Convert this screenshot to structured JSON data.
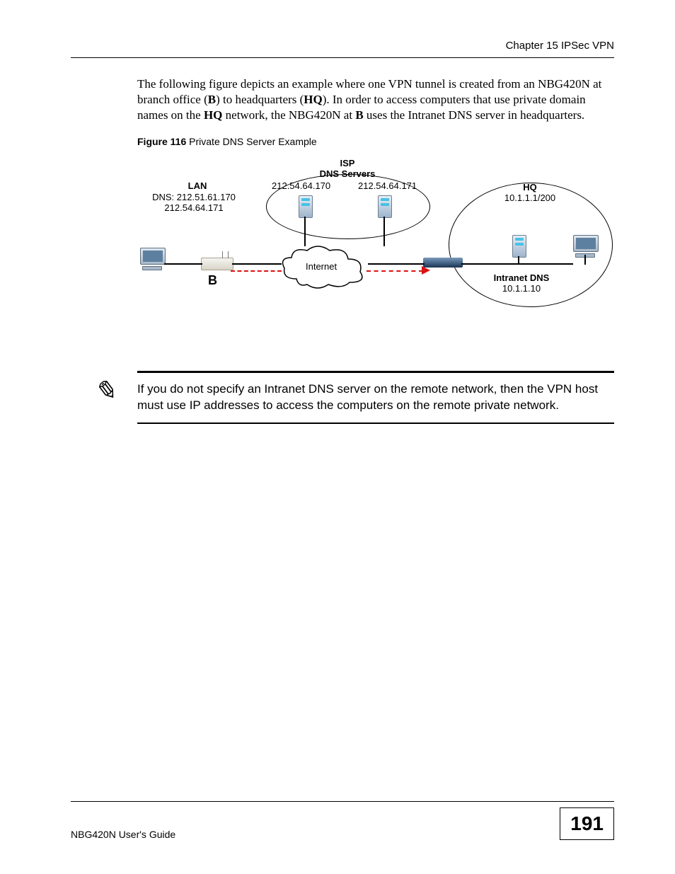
{
  "header": {
    "chapter": "Chapter 15 IPSec VPN"
  },
  "para": {
    "pre1": "The following figure depicts an example where one VPN tunnel is created from an NBG420N at branch office (",
    "b1": "B",
    "mid1": ") to headquarters (",
    "b2": "HQ",
    "mid2": "). In order to access computers that use private domain names on the ",
    "b3": "HQ",
    "mid3": " network, the NBG420N at ",
    "b4": "B",
    "post": " uses the Intranet DNS server in headquarters."
  },
  "figcap": {
    "bold": "Figure 116",
    "rest": "   Private DNS Server Example"
  },
  "diagram": {
    "isp_line1": "ISP",
    "isp_line2": "DNS Servers",
    "ip_left": "212.54.64.170",
    "ip_right": "212.54.64.171",
    "lan_title": "LAN",
    "lan_dns1": "DNS: 212.51.61.170",
    "lan_dns2": "212.54.64.171",
    "b_label": "B",
    "internet": "Internet",
    "hq_title": "HQ",
    "hq_ip": "10.1.1.1/200",
    "intranet_title": "Intranet DNS",
    "intranet_ip": "10.1.1.10"
  },
  "note": {
    "icon": "✎",
    "text": "If you do not specify an Intranet DNS server on the remote network, then the VPN host must use IP addresses to access the computers on the remote private network."
  },
  "footer": {
    "guide": "NBG420N User's Guide",
    "page": "191"
  }
}
